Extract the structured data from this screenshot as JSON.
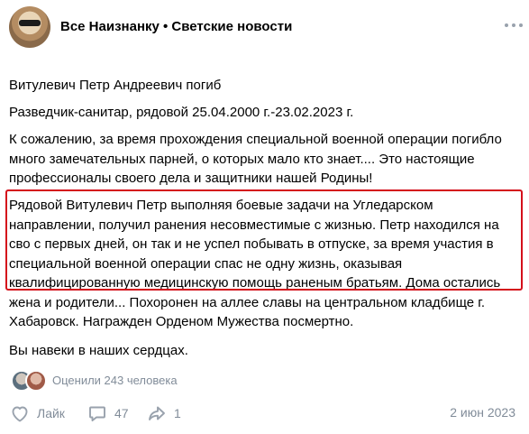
{
  "header": {
    "title": "Все Наизнанку • Светские новости",
    "avatar_icon": "avatar-man-sunglasses",
    "more_icon": "more-dots-icon"
  },
  "post": {
    "paragraphs": [
      "Витулевич Петр Андреевич погиб",
      "Разведчик-санитар, рядовой 25.04.2000 г.-23.02.2023 г.",
      "К сожалению, за время прохождения специальной военной операции погибло много замечательных парней, о которых мало кто знает.... Это настоящие профессионалы своего дела и защитники нашей Родины!",
      "Рядовой Витулевич Петр выполняя боевые задачи на Угледарском направлении, получил ранения несовместимые с жизнью. Петр находился на сво с первых дней, он так и не успел побывать в отпуске, за время участия в специальной военной операции спас не одну жизнь, оказывая квалифицированную медицинскую помощь раненым братьям. Дома остались жена и родители... Похоронен на аллее славы на центральном кладбище г. Хабаровск. Награжден Орденом Мужества посмертно.",
      "Вы навеки в наших сердцах."
    ],
    "highlight_color": "#d40f1b"
  },
  "reactions": {
    "text": "Оценили 243 человека"
  },
  "footer": {
    "like_label": "Лайк",
    "comments_count": "47",
    "shares_count": "1",
    "date": "2 июн 2023"
  },
  "colors": {
    "secondary_text": "#818c99",
    "icon_gray": "#99a2ad"
  }
}
